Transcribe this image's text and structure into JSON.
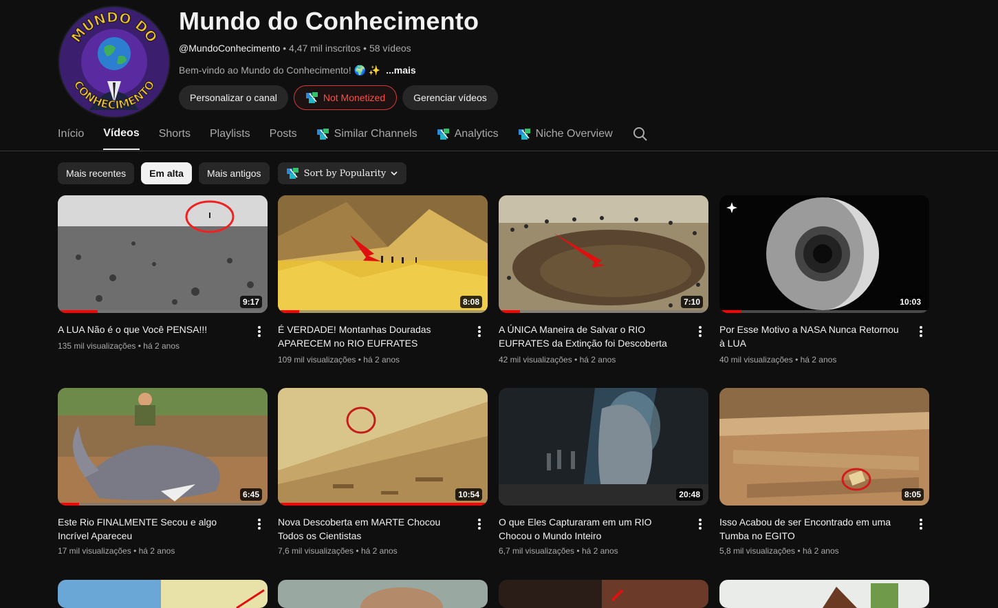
{
  "channel": {
    "title": "Mundo do Conhecimento",
    "handle": "@MundoConhecimento",
    "subscribers": "4,47 mil inscritos",
    "video_count": "58 vídeos",
    "separator": "•",
    "description": "Bem-vindo ao Mundo do Conhecimento! 🌍 ✨",
    "more_label": "...mais",
    "avatar_text_top": "MUNDO DO",
    "avatar_text_bottom": "CONHECIMENTO"
  },
  "actions": {
    "customize_label": "Personalizar o canal",
    "monetization_label": "Not Monetized",
    "manage_label": "Gerenciar vídeos"
  },
  "tabs": [
    {
      "label": "Início"
    },
    {
      "label": "Vídeos"
    },
    {
      "label": "Shorts"
    },
    {
      "label": "Playlists"
    },
    {
      "label": "Posts"
    },
    {
      "label": "Similar Channels"
    },
    {
      "label": "Analytics"
    },
    {
      "label": "Niche Overview"
    }
  ],
  "filters": {
    "recent": "Mais recentes",
    "popular": "Em alta",
    "oldest": "Mais antigos",
    "sort": "Sort by Popularity"
  },
  "videos": [
    {
      "title": "A LUA Não é o que Você PENSA!!!",
      "views": "135 mil visualizações",
      "age": "há 2 anos",
      "duration": "9:17",
      "progress": 0.19
    },
    {
      "title": "É VERDADE! Montanhas Douradas APARECEM no RIO EUFRATES",
      "views": "109 mil visualizações",
      "age": "há 2 anos",
      "duration": "8:08",
      "progress": 0.1
    },
    {
      "title": "A ÚNICA Maneira de Salvar o RIO EUFRATES da Extinção foi Descoberta",
      "views": "42 mil visualizações",
      "age": "há 2 anos",
      "duration": "7:10",
      "progress": 0.1
    },
    {
      "title": "Por Esse Motivo a NASA Nunca Retornou à LUA",
      "views": "40 mil visualizações",
      "age": "há 2 anos",
      "duration": "10:03",
      "progress": 0.1
    },
    {
      "title": "Este Rio FINALMENTE Secou e algo Incrível Apareceu",
      "views": "17 mil visualizações",
      "age": "há 2 anos",
      "duration": "6:45",
      "progress": 0.1
    },
    {
      "title": "Nova Descoberta em MARTE Chocou Todos os Cientistas",
      "views": "7,6 mil visualizações",
      "age": "há 2 anos",
      "duration": "10:54",
      "progress": 1.0
    },
    {
      "title": "O que Eles Capturaram em um RIO Chocou o Mundo Inteiro",
      "views": "6,7 mil visualizações",
      "age": "há 2 anos",
      "duration": "20:48",
      "progress": 0
    },
    {
      "title": "Isso Acabou de ser Encontrado em uma Tumba no EGITO",
      "views": "5,8 mil visualizações",
      "age": "há 2 anos",
      "duration": "8:05",
      "progress": 0
    }
  ],
  "colors": {
    "background": "#0f0f0f",
    "accent_red": "#ff0000",
    "danger_border": "#d33a3a",
    "chip_bg": "#272727"
  },
  "icons": [
    "search-icon",
    "chevron-down-icon",
    "more-vert-icon",
    "extension-logo-icon",
    "sparkle-icon"
  ]
}
